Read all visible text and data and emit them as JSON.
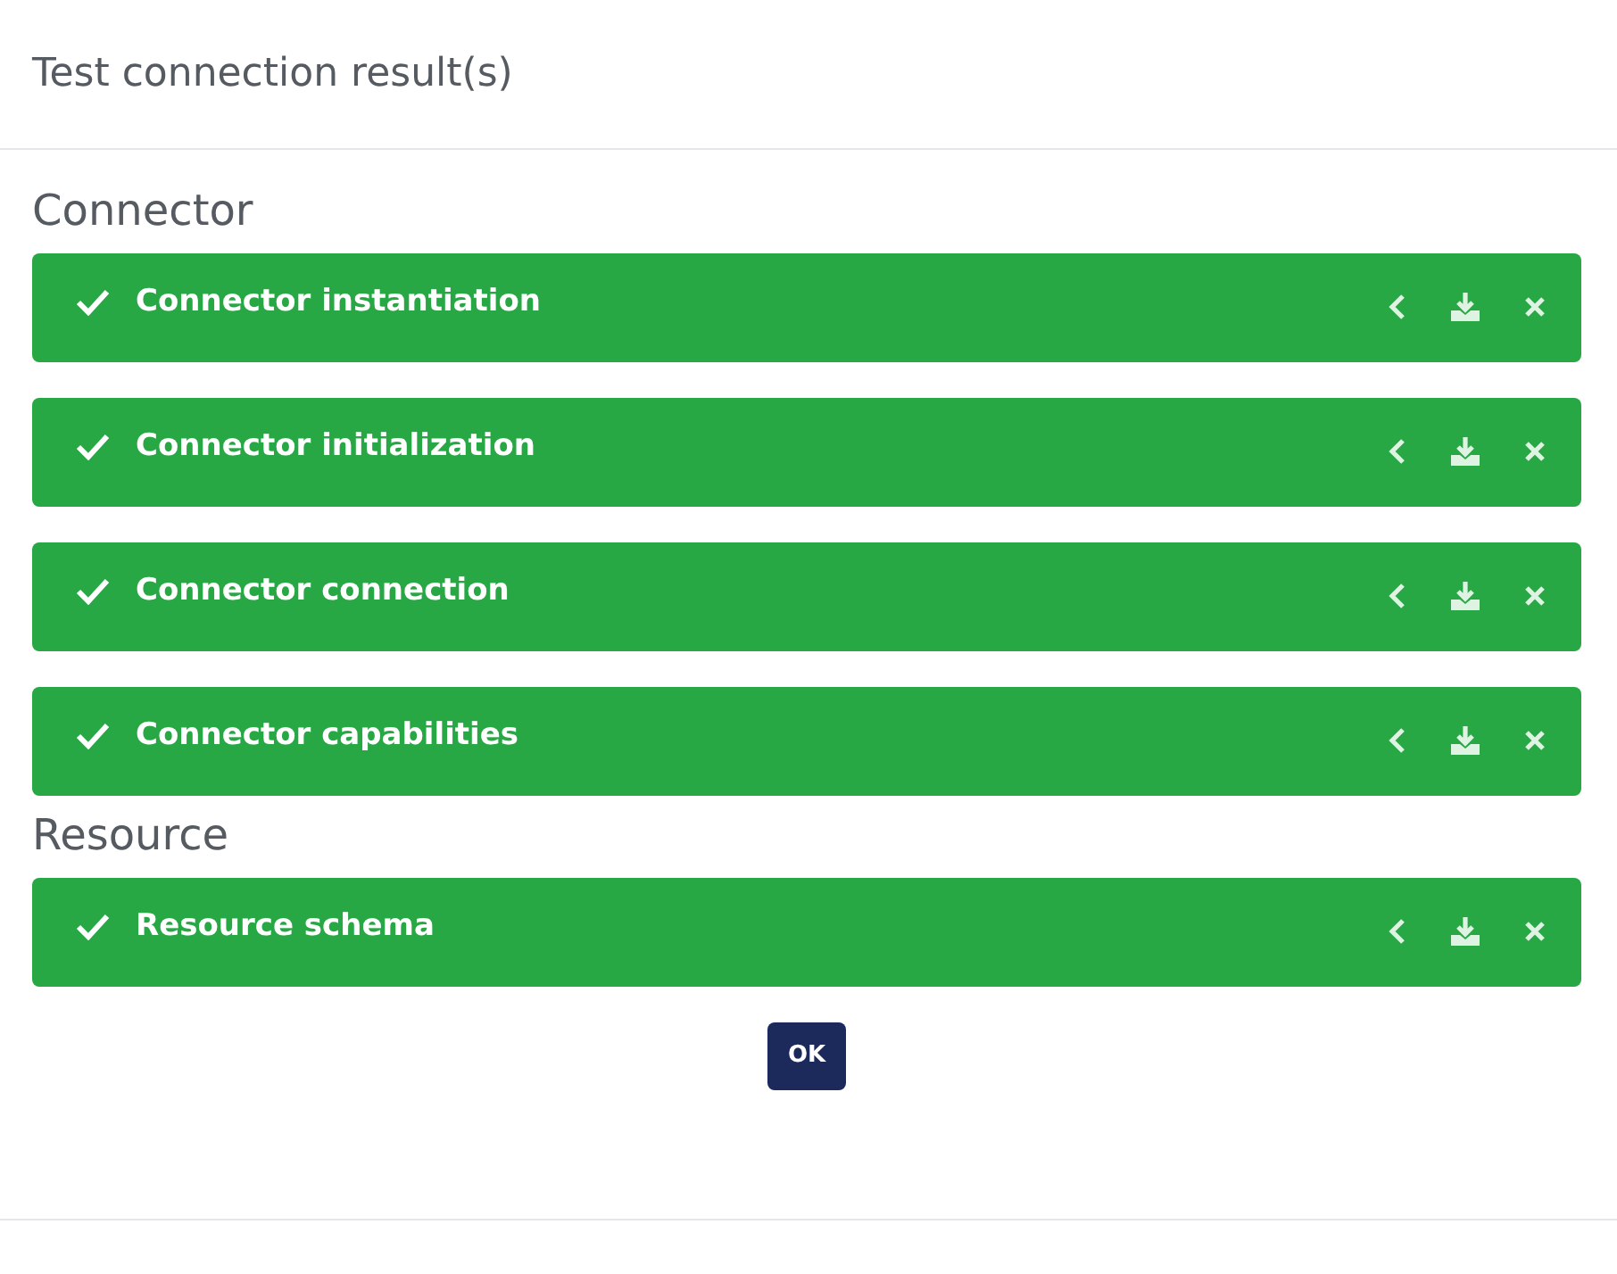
{
  "dialog": {
    "title": "Test connection result(s)"
  },
  "sections": [
    {
      "title": "Connector",
      "results": [
        {
          "label": "Connector instantiation",
          "passed": true
        },
        {
          "label": "Connector initialization",
          "passed": true
        },
        {
          "label": "Connector connection",
          "passed": true
        },
        {
          "label": "Connector capabilities",
          "passed": true
        }
      ]
    },
    {
      "title": "Resource",
      "results": [
        {
          "label": "Resource schema",
          "passed": true
        }
      ]
    }
  ],
  "buttons": [
    "OK"
  ]
}
